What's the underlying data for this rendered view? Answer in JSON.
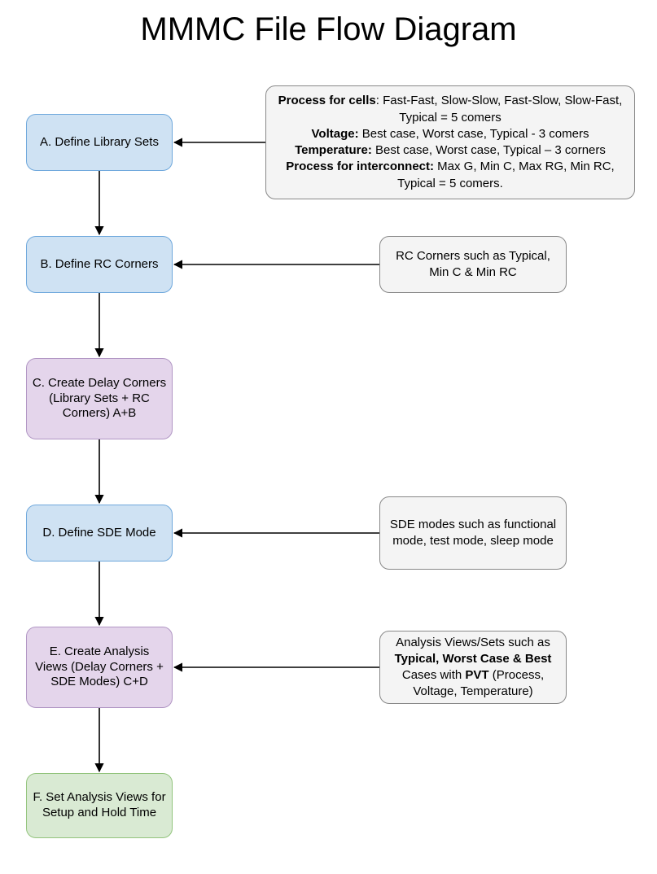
{
  "title": "MMMC File Flow Diagram",
  "flow": {
    "A": "A. Define Library Sets",
    "B": "B. Define RC Corners",
    "C": "C. Create Delay Corners (Library Sets + RC Corners) A+B",
    "D": "D. Define SDE Mode",
    "E": "E. Create Analysis Views (Delay Corners + SDE Modes) C+D",
    "F": "F. Set Analysis Views for Setup and Hold Time"
  },
  "note_A": {
    "l1_bold": "Process for cells",
    "l1_rest": ": Fast-Fast, Slow-Slow, Fast-Slow, Slow-Fast, Typical = 5 comers",
    "l2_bold": "Voltage:",
    "l2_rest": " Best case, Worst case, Typical - 3 comers",
    "l3_bold": "Temperature:",
    "l3_rest": " Best case, Worst case, Typical – 3 corners",
    "l4_bold": "Process for interconnect:",
    "l4_rest": " Max G, Min C, Max RG, Min RC, Typical = 5 comers."
  },
  "note_B": "RC Corners such as Typical, Min C & Min RC",
  "note_D": "SDE modes such as functional mode, test mode, sleep mode",
  "note_E": {
    "pre": "Analysis Views/Sets such as ",
    "bold1": "Typical, Worst Case & Best",
    "mid": " Cases with ",
    "bold2": "PVT",
    "post": " (Process, Voltage, Temperature)"
  }
}
